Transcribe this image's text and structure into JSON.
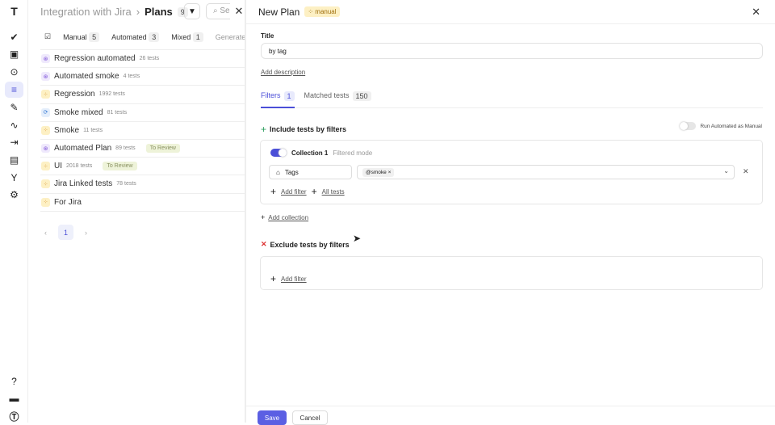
{
  "rail": {
    "icons": [
      "logo-icon",
      "check-icon",
      "clipboard-icon",
      "play-icon",
      "plans-icon",
      "pen-icon",
      "pulse-icon",
      "import-icon",
      "chart-icon",
      "branch-icon",
      "gear-icon",
      "help-icon",
      "folder-icon",
      "account-icon"
    ],
    "active": "plans-icon"
  },
  "left": {
    "breadcrumb": {
      "project": "Integration with Jira",
      "separator": "›",
      "current": "Plans",
      "count": "9"
    },
    "search_placeholder": "Se",
    "tabs": [
      {
        "label": "Manual",
        "count": "5"
      },
      {
        "label": "Automated",
        "count": "3"
      },
      {
        "label": "Mixed",
        "count": "1"
      },
      {
        "label": "Generated",
        "count": ""
      }
    ],
    "plans": [
      {
        "title": "Regression automated",
        "tests": "26 tests",
        "type": "automated",
        "badge": ""
      },
      {
        "title": "Automated smoke",
        "tests": "4 tests",
        "type": "automated",
        "badge": ""
      },
      {
        "title": "Regression",
        "tests": "1992 tests",
        "type": "manual",
        "badge": ""
      },
      {
        "title": "Smoke mixed",
        "tests": "81 tests",
        "type": "mixed",
        "badge": ""
      },
      {
        "title": "Smoke",
        "tests": "11 tests",
        "type": "manual",
        "badge": ""
      },
      {
        "title": "Automated Plan",
        "tests": "89 tests",
        "type": "automated",
        "badge": "To Review"
      },
      {
        "title": "UI",
        "tests": "2018 tests",
        "type": "manual",
        "badge": "To Review"
      },
      {
        "title": "Jira Linked tests",
        "tests": "78 tests",
        "type": "manual",
        "badge": ""
      },
      {
        "title": "For Jira",
        "tests": "",
        "type": "manual",
        "badge": ""
      }
    ],
    "pager": {
      "page": "1",
      "prev": "‹",
      "next": "›"
    }
  },
  "panel": {
    "title": "New Plan",
    "type_badge": "manual",
    "title_label": "Title",
    "title_value": "by tag",
    "add_description": "Add description",
    "tabs": [
      {
        "label": "Filters",
        "count": "1"
      },
      {
        "label": "Matched tests",
        "count": "150"
      }
    ],
    "include": {
      "label": "Include tests by filters",
      "run_as_manual": "Run Automated as Manual",
      "run_as_manual_on": false
    },
    "collection": {
      "name": "Collection 1",
      "mode": "Filtered mode",
      "enabled": true,
      "field": "Tags",
      "chips": [
        "@smoke"
      ],
      "add_filter": "Add filter",
      "all_tests": "All tests"
    },
    "add_collection": "Add collection",
    "exclude": {
      "label": "Exclude tests by filters",
      "add_filter": "Add filter"
    },
    "save": "Save",
    "cancel": "Cancel"
  },
  "colors": {
    "accent": "#4b4fd8",
    "automated": "#7b4fd8",
    "manual": "#e8a020",
    "mixed": "#3a7bd5",
    "exclude": "#d33",
    "include": "#2a9d5c"
  }
}
